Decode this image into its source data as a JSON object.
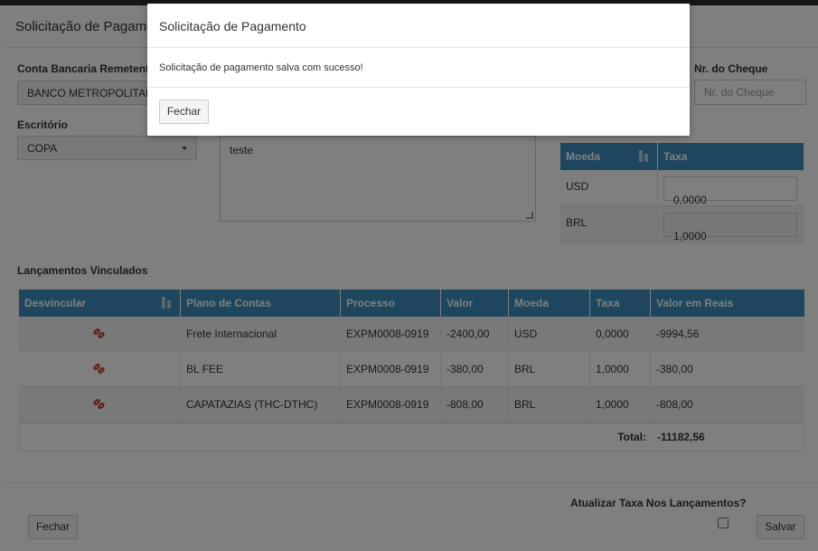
{
  "page": {
    "title": "Solicitação de Pagamento",
    "sender_account": {
      "label": "Conta Bancaria Remetente",
      "value": "BANCO METROPOLITANO"
    },
    "check_number": {
      "label": "Nr. do Cheque",
      "placeholder": "Nr. do Cheque"
    },
    "office": {
      "label": "Escritório",
      "value": "COPA"
    },
    "notes": {
      "value": "teste"
    },
    "currency_table": {
      "headers": [
        "Moeda",
        "Taxa"
      ],
      "rows": [
        {
          "currency": "USD",
          "rate": "0,0000"
        },
        {
          "currency": "BRL",
          "rate": "1,0000"
        }
      ]
    },
    "linked_section_title": "Lançamentos Vinculados",
    "linked_table": {
      "headers": [
        "Desvincular",
        "Plano de Contas",
        "Processo",
        "Valor",
        "Moeda",
        "Taxa",
        "Valor em Reais"
      ],
      "rows": [
        {
          "account": "Frete Internacional",
          "process": "EXPM0008-0919",
          "value": "-2400,00",
          "currency": "USD",
          "rate": "0,0000",
          "value_brl": "-9994,56"
        },
        {
          "account": "BL FEE",
          "process": "EXPM0008-0919",
          "value": "-380,00",
          "currency": "BRL",
          "rate": "1,0000",
          "value_brl": "-380,00"
        },
        {
          "account": "CAPATAZIAS (THC-DTHC)",
          "process": "EXPM0008-0919",
          "value": "-808,00",
          "currency": "BRL",
          "rate": "1,0000",
          "value_brl": "-808,00"
        }
      ],
      "total_label": "Total:",
      "total_value": "-11182,56"
    },
    "update_rate_label": "Atualizar Taxa Nos Lançamentos?",
    "close_button": "Fechar",
    "save_button": "Salvar"
  },
  "modal": {
    "title": "Solicitação de Pagamento",
    "message": "Solicitação de pagamento salva com sucesso!",
    "close_button": "Fechar"
  },
  "colors": {
    "table_header": "#3c8dbc",
    "unlink_icon": "#c0392b",
    "overlay": "rgba(0,0,0,0.5)"
  }
}
